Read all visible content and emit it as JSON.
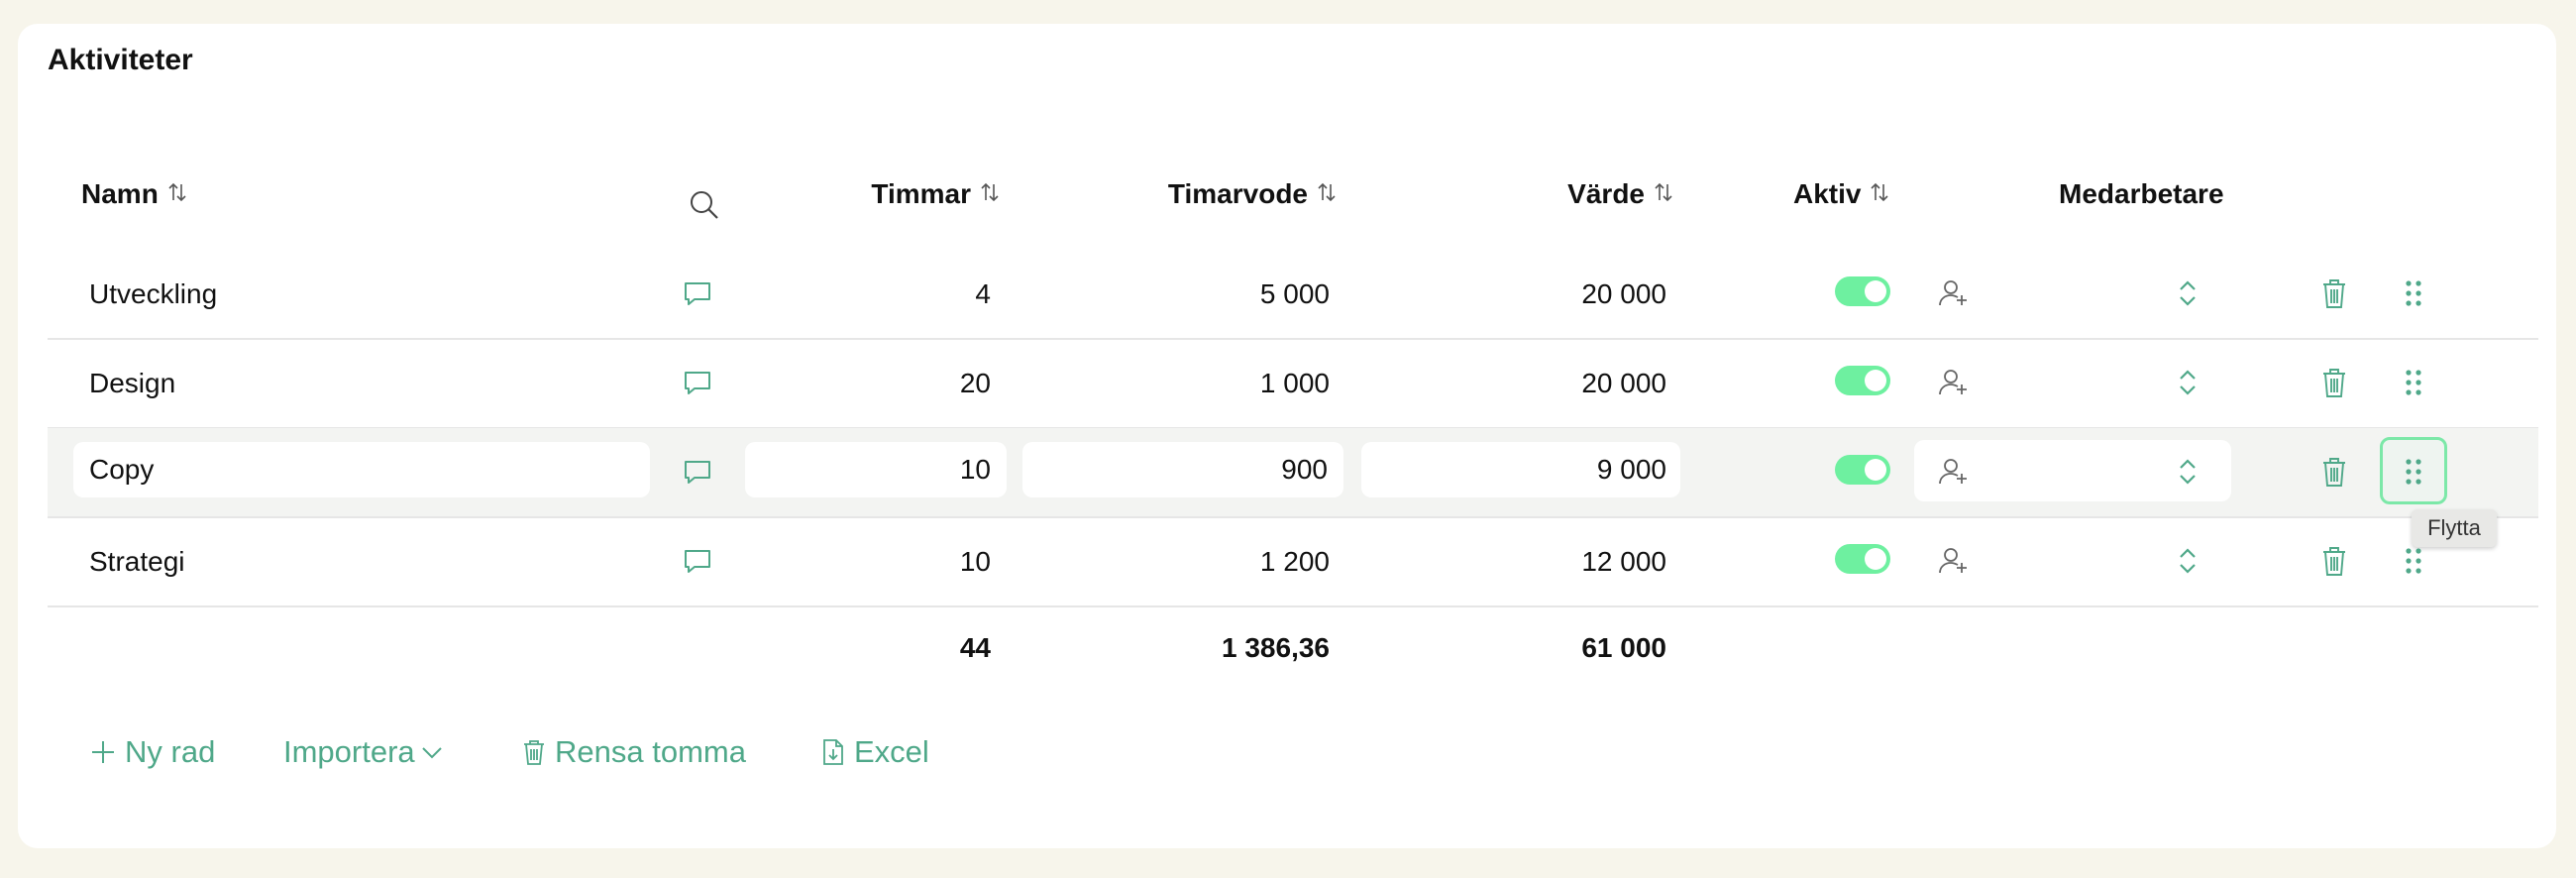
{
  "section": {
    "title": "Aktiviteter"
  },
  "columns": {
    "name": "Namn",
    "hours": "Timmar",
    "rate": "Timarvode",
    "value": "Värde",
    "active": "Aktiv",
    "staff": "Medarbetare"
  },
  "rows": [
    {
      "name": "Utveckling",
      "hours": "4",
      "rate": "5 000",
      "value": "20 000",
      "active": true
    },
    {
      "name": "Design",
      "hours": "20",
      "rate": "1 000",
      "value": "20 000",
      "active": true
    },
    {
      "name": "Copy",
      "hours": "10",
      "rate": "900",
      "value": "9 000",
      "active": true
    },
    {
      "name": "Strategi",
      "hours": "10",
      "rate": "1 200",
      "value": "12 000",
      "active": true
    }
  ],
  "totals": {
    "hours": "44",
    "rate": "1 386,36",
    "value": "61 000"
  },
  "tooltip": {
    "text": "Flytta"
  },
  "actions": {
    "new_row": "Ny rad",
    "import": "Importera",
    "clear_empty": "Rensa tomma",
    "excel": "Excel"
  },
  "colors": {
    "accent": "#4fa889",
    "toggle": "#6ef0a0",
    "background": "#f7f5eb"
  },
  "icons": [
    "sort-icon",
    "search-icon",
    "comment-icon",
    "add-user-icon",
    "chevron-updown-icon",
    "trash-icon",
    "drag-handle-icon",
    "plus-icon",
    "chevron-down-icon",
    "file-download-icon"
  ]
}
